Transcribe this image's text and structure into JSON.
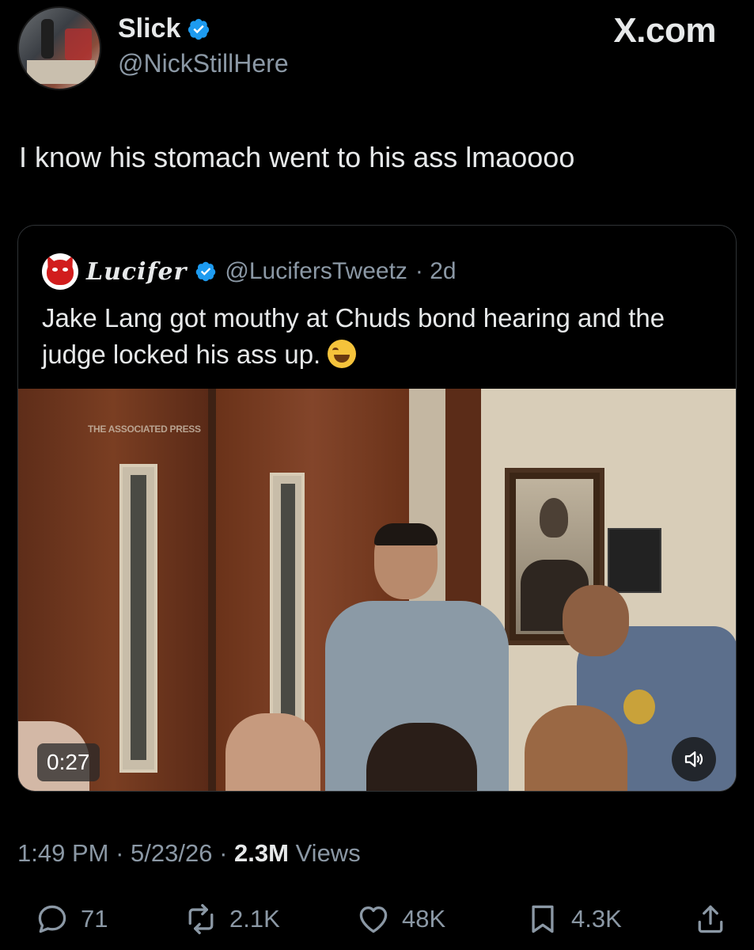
{
  "author": {
    "display_name": "Slick",
    "handle": "@NickStillHere"
  },
  "site_label": "X.com",
  "tweet_text": "I know his stomach went to his ass lmaoooo",
  "quoted_tweet": {
    "display_name": "Lucifer",
    "handle": "@LucifersTweetz",
    "age": "· 2d",
    "text": "Jake Lang got mouthy at Chuds bond hearing and the judge locked his ass up.",
    "emoji": "😂",
    "media": {
      "watermark": "THE ASSOCIATED PRESS",
      "duration": "0:27"
    }
  },
  "meta": {
    "time": "1:49 PM",
    "date": "5/23/26",
    "views_count": "2.3M",
    "views_label": "Views"
  },
  "actions": {
    "replies": "71",
    "reposts": "2.1K",
    "likes": "48K",
    "bookmarks": "4.3K"
  },
  "colors": {
    "background": "#000000",
    "text": "#e7e9ea",
    "secondary": "#8b98a5",
    "verified": "#1d9bf0"
  }
}
